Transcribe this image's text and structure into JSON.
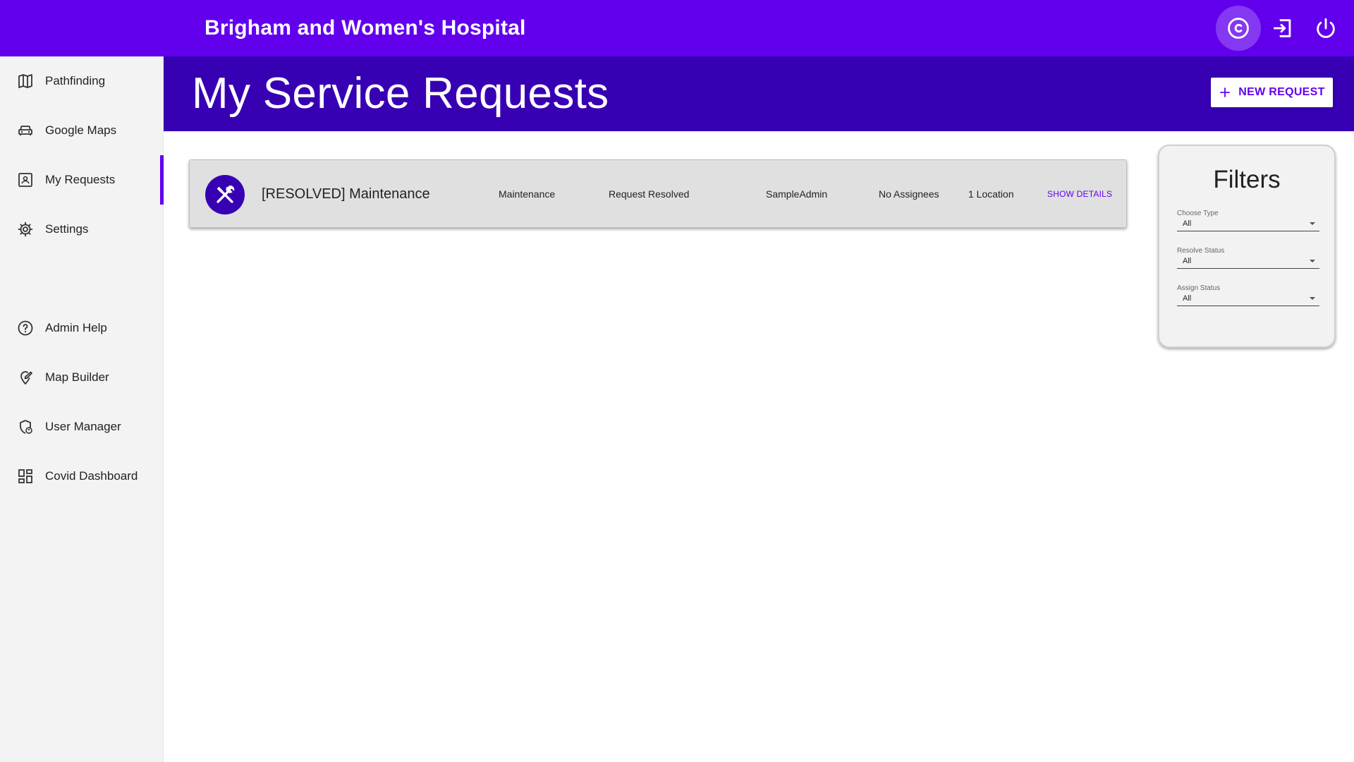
{
  "header": {
    "app_title": "Brigham and Women's Hospital",
    "icons": [
      "copyright-icon",
      "login-icon",
      "power-icon"
    ]
  },
  "sidebar": {
    "items": [
      {
        "label": "Pathfinding",
        "icon": "map-icon"
      },
      {
        "label": "Google Maps",
        "icon": "car-icon"
      },
      {
        "label": "My Requests",
        "icon": "request-icon",
        "selected": true
      },
      {
        "label": "Settings",
        "icon": "gear-icon"
      },
      {
        "label": "Admin Help",
        "icon": "help-icon"
      },
      {
        "label": "Map Builder",
        "icon": "edit-map-icon"
      },
      {
        "label": "User Manager",
        "icon": "user-manager-icon"
      },
      {
        "label": "Covid Dashboard",
        "icon": "dashboard-icon"
      }
    ]
  },
  "main": {
    "page_title": "My Service Requests",
    "new_request_label": "NEW REQUEST",
    "requests": [
      {
        "title": "[RESOLVED] Maintenance",
        "type": "Maintenance",
        "status": "Request Resolved",
        "requester": "SampleAdmin",
        "assignees": "No Assignees",
        "locations": "1 Location",
        "details_label": "SHOW DETAILS",
        "icon": "tools-icon"
      }
    ]
  },
  "filters": {
    "title": "Filters",
    "fields": [
      {
        "label": "Choose Type",
        "value": "All"
      },
      {
        "label": "Resolve Status",
        "value": "All"
      },
      {
        "label": "Assign Status",
        "value": "All"
      }
    ]
  },
  "colors": {
    "primary": "#6200ee",
    "primary_dark": "#3700b3",
    "sidebar_bg": "#f3f3f3",
    "card_bg": "#e0e0e0"
  }
}
